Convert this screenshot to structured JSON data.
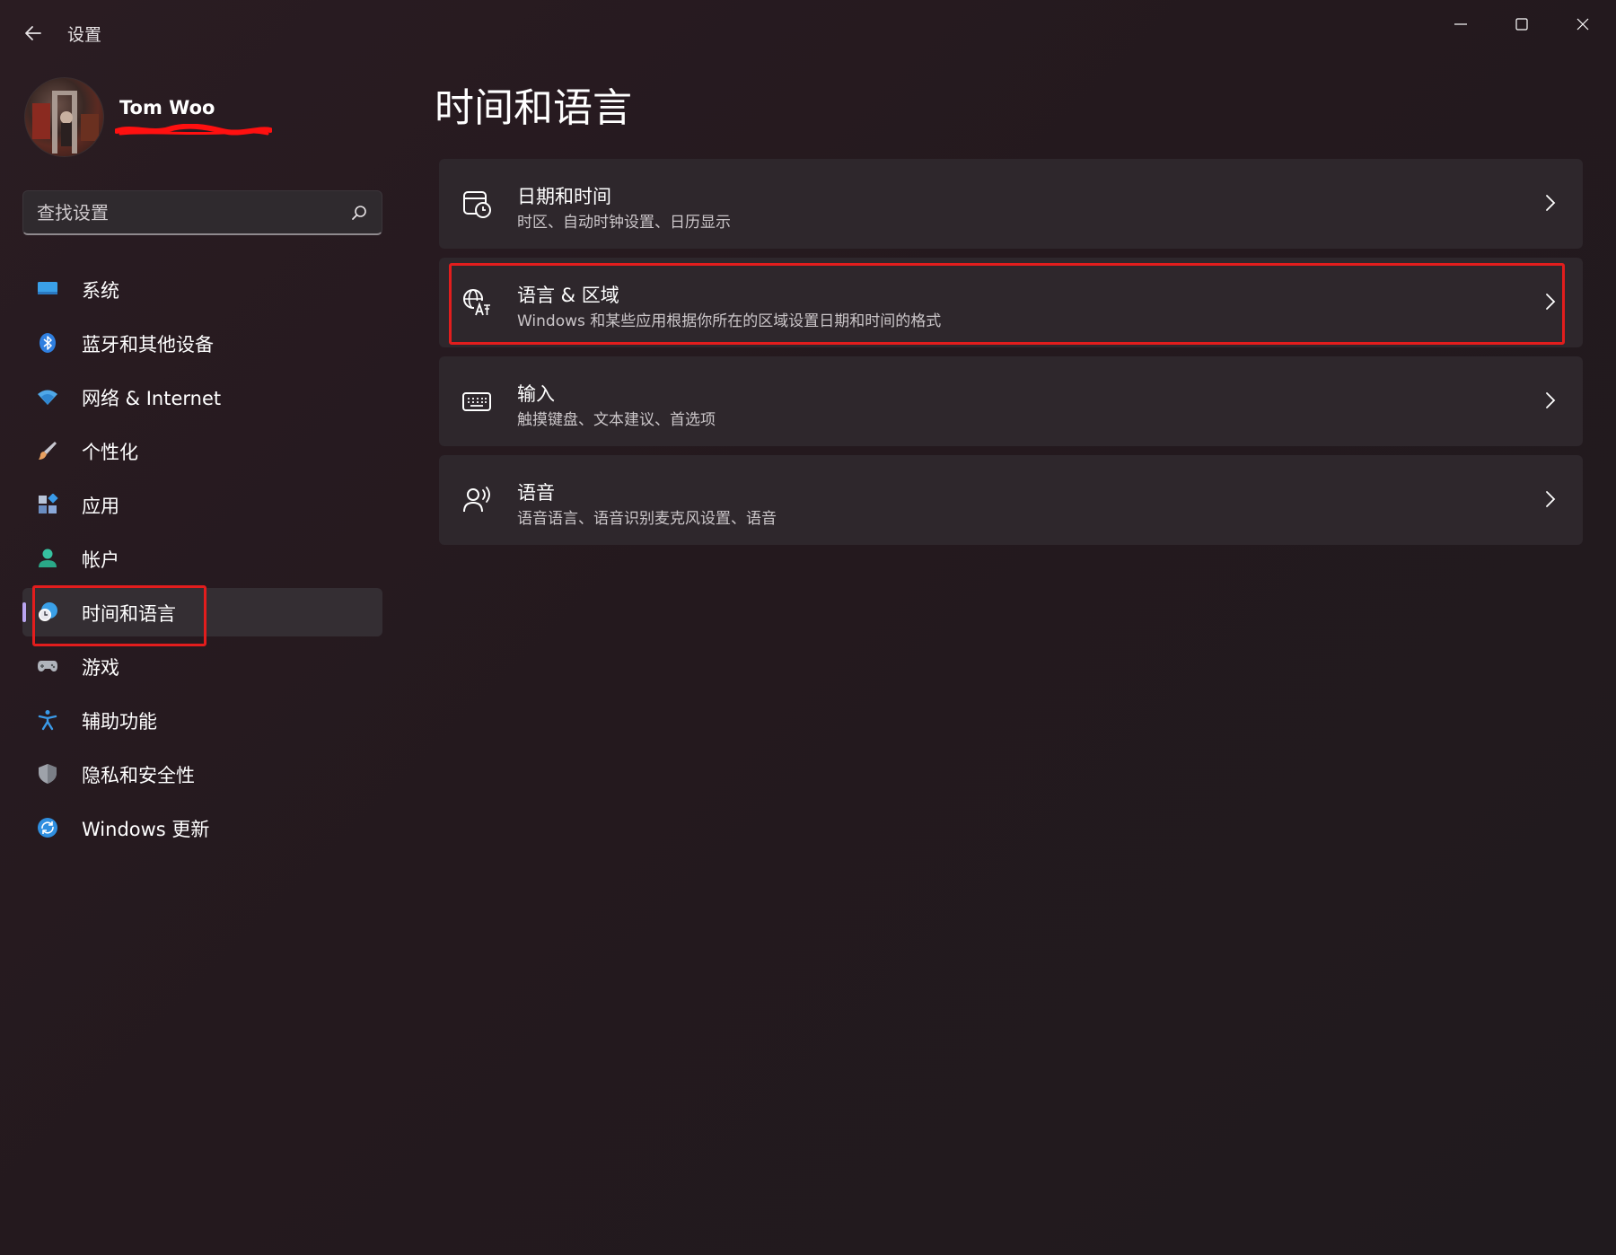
{
  "app": {
    "title": "设置"
  },
  "profile": {
    "name": "Tom Woo"
  },
  "search": {
    "placeholder": "查找设置"
  },
  "nav": {
    "items": [
      {
        "label": "系统",
        "icon": "monitor-icon",
        "color": "#3aa0e8"
      },
      {
        "label": "蓝牙和其他设备",
        "icon": "bluetooth-icon",
        "color": "#2f7fe0"
      },
      {
        "label": "网络 & Internet",
        "icon": "wifi-icon",
        "color": "#4fa8e8"
      },
      {
        "label": "个性化",
        "icon": "paintbrush-icon",
        "color": "#e8a060"
      },
      {
        "label": "应用",
        "icon": "apps-icon",
        "color": "#8aa8d8"
      },
      {
        "label": "帐户",
        "icon": "person-icon",
        "color": "#36c2a0"
      },
      {
        "label": "时间和语言",
        "icon": "clock-globe-icon",
        "color": "#3aa0e8",
        "selected": true
      },
      {
        "label": "游戏",
        "icon": "gamepad-icon",
        "color": "#b0b4bc"
      },
      {
        "label": "辅助功能",
        "icon": "accessibility-icon",
        "color": "#3a9ae8"
      },
      {
        "label": "隐私和安全性",
        "icon": "shield-icon",
        "color": "#9ea2aa"
      },
      {
        "label": "Windows 更新",
        "icon": "sync-icon",
        "color": "#2f8fe0"
      }
    ]
  },
  "main": {
    "title": "时间和语言",
    "cards": [
      {
        "title": "日期和时间",
        "desc": "时区、自动时钟设置、日历显示",
        "icon": "calendar-clock-icon"
      },
      {
        "title": "语言 & 区域",
        "desc": "Windows 和某些应用根据你所在的区域设置日期和时间的格式",
        "icon": "language-icon"
      },
      {
        "title": "输入",
        "desc": "触摸键盘、文本建议、首选项",
        "icon": "keyboard-icon"
      },
      {
        "title": "语音",
        "desc": "语音语言、语音识别麦克风设置、语音",
        "icon": "speech-icon"
      }
    ]
  },
  "colors": {
    "accent": "#b9a5f0",
    "highlight": "#e21d1d",
    "card": "#2e272c"
  }
}
